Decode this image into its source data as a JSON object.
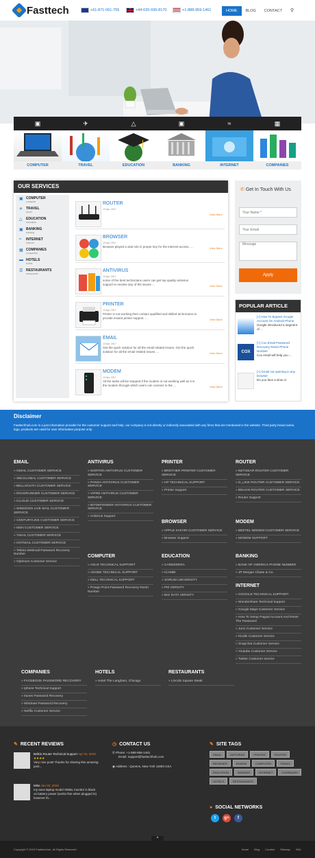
{
  "header": {
    "logo_text": "Fasttech",
    "phones": [
      {
        "flag": "au",
        "number": "+61-871-061-755"
      },
      {
        "flag": "uk",
        "number": "+44-020-936-8170"
      },
      {
        "flag": "us",
        "number": "+1-888-959-1461"
      }
    ],
    "nav": [
      {
        "label": "HOME",
        "active": true
      },
      {
        "label": "BLOG"
      },
      {
        "label": "CONTACT"
      }
    ],
    "search_icon": "search-icon"
  },
  "categories": {
    "icons": [
      "monitor-icon",
      "plane-icon",
      "graduation-cap-icon",
      "money-icon",
      "wifi-icon",
      "building-icon"
    ],
    "labels": [
      "COMPUTER",
      "TRAVEL",
      "EDUCATION",
      "BANKING",
      "INTERNET",
      "COMPANIES"
    ]
  },
  "services": {
    "title": "OUR SERVICES",
    "menu": [
      {
        "label": "COMPUTER",
        "sub": "computer"
      },
      {
        "label": "TRAVEL",
        "sub": "travel"
      },
      {
        "label": "EDUCATION",
        "sub": "education"
      },
      {
        "label": "BANKING",
        "sub": "banking"
      },
      {
        "label": "INTERNET",
        "sub": "internet"
      },
      {
        "label": "COMPANIES",
        "sub": "companies"
      },
      {
        "label": "HOTELS",
        "sub": "hotels"
      },
      {
        "label": "RESTAURANTS",
        "sub": "restaurants"
      }
    ],
    "items": [
      {
        "name": "ROUTER",
        "date": "13 Apr, 2017",
        "desc": "",
        "view": "View More"
      },
      {
        "name": "BROWSER",
        "date": "13 Apr, 2017",
        "desc": "Browser played a vital role in proper key for the internet access. ...",
        "view": "View More"
      },
      {
        "name": "ANTIVIRUS",
        "date": "13 Apr, 2017",
        "desc": "some of the best technicians users can get top quality antivirus support to resolve any of the issues ...",
        "view": "View More"
      },
      {
        "name": "PRINTER",
        "date": "13 Apr, 2017",
        "desc": "Printer is not working then contact qualified and skilled technicians to provide instant printer support. ...",
        "view": "View More"
      },
      {
        "name": "EMAIL",
        "date": "13 Apr, 2017",
        "desc": "Get the quick solution for all the email related issues. Get the quick solution for all the email related issues. ...",
        "view": "View More"
      },
      {
        "name": "MODEM",
        "date": "13 Apr, 2017",
        "desc": "All the tasks will be stopped if the modem is not working well as it is the modem through which users can connect to the ...",
        "view": "View More"
      }
    ]
  },
  "contact_form": {
    "title": "Get In Touch With Us",
    "name_placeholder": "Your Name *",
    "email_placeholder": "Your Email",
    "message_placeholder": "Message",
    "submit": "Apply"
  },
  "popular": {
    "title": "POPULAR ARTICLE",
    "items": [
      {
        "title": "[+] How To Bypass Google Account On Android Phone",
        "excerpt": "Google introduced a segment of ..."
      },
      {
        "title": "[+] Cox Email Password Recovery Reset Phone Number",
        "excerpt": "Cox email will help you ..."
      },
      {
        "title": "[+] Gmail not opening in any browser",
        "excerpt": "Do you face a slow or"
      }
    ]
  },
  "disclaimer": {
    "title": "Disclaimer",
    "text": "Fasttechhub.com is a just information provider for the customer support and help. our company is not directly or indirectly associated with any firms that are mentioned in the website. Third party brand name, logo, products are used for user information purpose only."
  },
  "footer_columns": [
    {
      "title": "EMAIL",
      "links": [
        "GMAIL CUSTOMER SERVICE",
        "SBCGLOBAL CUSTOMER SERVICE",
        "BELLSOUTH CUSTOMER SERVICE",
        "ROADRUNNER CUSTOMER SERVICE",
        "ICLOUD CUSTOMER SERVICE",
        "WINDOWS LIVE MAIL CUSTOMER SERVICE",
        "CENTURYLINK CUSTOMER SERVICE",
        "MSN CUSTOMER SERVICE",
        "YMAIL CUSTOMER SERVICE",
        "HOTMAIL CUSTOMER SERVICE",
        "Telstra Webmail Password Recovery Number",
        "Optimum Customer Service"
      ]
    },
    {
      "title": "ANTIVIRUS",
      "links": [
        "NORTON ANTIVIRUS CUSTOMER SERVICE",
        "PANDA ANTIVIRUS CUSTOMER SERVICE",
        "VIPRE ANTIVIRUS CUSTOMER SERVICE",
        "BITDEFENDER ANTIVIRUS CUSTOMER SERVICE",
        "Antivirus Support"
      ]
    },
    {
      "title": "PRINTER",
      "links": [
        "BROTHER PRINTER CUSTOMER SERVICE",
        "HP TECHNICAL SUPPORT",
        "Printer Support"
      ]
    },
    {
      "title": "ROUTER",
      "links": [
        "NETGEAR ROUTER CUSTOMER SERVICE",
        "D_LINK ROUTER CUSTOMER SERVICE",
        "BELKIN ROUTER CUSTOMER SERVICE",
        "Router Support"
      ]
    },
    {
      "title": "BROWSER",
      "links": [
        "APPLE SAFARI CUSTOMER SERVICE",
        "Browser Support"
      ]
    },
    {
      "title": "MODEM",
      "links": [
        "BEETEL MODEM CUSTOMER SERVICE",
        "MODEM SUPPORT"
      ]
    },
    {
      "title": "COMPUTER",
      "links": [
        "ASUS TECHNICAL SUPPORT",
        "ADOBE TECHNICAL SUPPORT",
        "DELL TECHNICAL SUPPORT",
        "Powgo Point Password Recovery Reset Number"
      ]
    },
    {
      "title": "EDUCATION",
      "links": [
        "CAREERERA",
        "ICAMBI",
        "SORUM UNIVERSITY",
        "PM VERSITY",
        "BIG DATA VERSITY"
      ]
    },
    {
      "title": "BANKING",
      "links": [
        "BANK OF AMERICA PHONE NUMBER",
        "JP Morgan Chase & Co."
      ]
    },
    {
      "title": "INTERNET",
      "links": [
        "GOOGLE TECHNICAL SUPPORT",
        "Wondershare Technical Support",
        "Google Maps Customer Service",
        "How To Setup Paypal Account And Reset The Password",
        "Juno Customer Service",
        "Kindle Customer Service",
        "Snapchat Customer Service",
        "Youtube Customer Service",
        "Twitter Customer service"
      ]
    },
    {
      "title": "COMPANIES",
      "links": [
        "FACEBOOK PASSWORD RECOVERY",
        "Iphone Technical Support",
        "Itunes Password Recovery",
        "Windows Password Recovery",
        "Netflix Customer Service"
      ]
    },
    {
      "title": "HOTELS",
      "links": [
        "Hotel The Langham, Chicago"
      ]
    },
    {
      "title": "RESTAURANTS",
      "links": [
        "Lincoln Square Steak"
      ]
    }
  ],
  "bottom": {
    "reviews_title": "RECENT REVIEWS",
    "reviews": [
      {
        "name": "Belkin Router Technical Support",
        "date": "Apr 03, 2019",
        "stars": "★★★★",
        "text": "Very nice post! Thanks for sharing this amazing post..."
      },
      {
        "name": "Mike",
        "date": "Jan 03, 2019",
        "stars": "",
        "text": "my asus laptop model X555L monitor is black on battery power (works fine when plugged in) however th..."
      }
    ],
    "contact_title": "CONTACT US",
    "phone": "Phone: +1-888-959-1461",
    "email": "Email: support@fasttechhub.com",
    "address": "Address : Queens, New York 11693 USA",
    "tags_title": "SITE TAGS",
    "tags": [
      "EMAIL",
      "ANTIVIRUS",
      "PRINTER",
      "ROUTER",
      "BROWSER",
      "MODEM",
      "COMPUTER",
      "TRAVEL",
      "EDUCATION",
      "BANKING",
      "INTERNET",
      "COMPANIES",
      "HOTELS",
      "RESTAURANTS"
    ],
    "social_title": "SOCIAL NETWORKS",
    "social": [
      {
        "icon": "twitter-icon",
        "glyph": "t",
        "color": "#1da1f2"
      },
      {
        "icon": "google-plus-icon",
        "glyph": "g+",
        "color": "#dd4b39"
      },
      {
        "icon": "facebook-icon",
        "glyph": "f",
        "color": "#3b5998"
      }
    ]
  },
  "bottom_bar": {
    "copyright": "Copyright © 2019 Fasttechhub. All Rights Reserved",
    "links": [
      "Home",
      "Blog",
      "Contact",
      "Sitemap",
      "XML"
    ],
    "to_top": "^"
  }
}
